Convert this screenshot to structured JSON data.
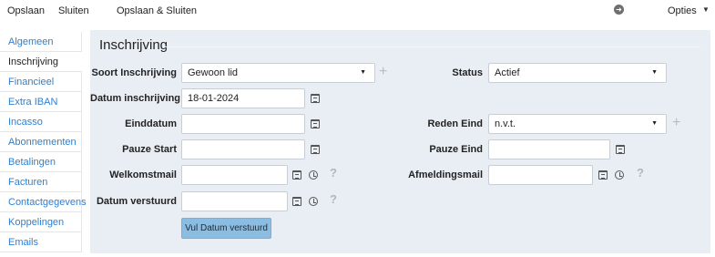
{
  "toolbar": {
    "save_label": "Opslaan",
    "close_label": "Sluiten",
    "save_close_label": "Opslaan & Sluiten",
    "options_label": "Opties"
  },
  "sidebar": {
    "items": [
      {
        "label": "Algemeen"
      },
      {
        "label": "Inschrijving",
        "active": true
      },
      {
        "label": "Financieel"
      },
      {
        "label": "Extra IBAN"
      },
      {
        "label": "Incasso"
      },
      {
        "label": "Abonnementen"
      },
      {
        "label": "Betalingen"
      },
      {
        "label": "Facturen"
      },
      {
        "label": "Contactgegevens"
      },
      {
        "label": "Koppelingen"
      },
      {
        "label": "Emails"
      }
    ]
  },
  "form": {
    "title": "Inschrijving",
    "soort_label": "Soort Inschrijving",
    "soort_value": "Gewoon lid",
    "status_label": "Status",
    "status_value": "Actief",
    "datum_label": "Datum inschrijving",
    "datum_value": "18-01-2024",
    "einddatum_label": "Einddatum",
    "reden_label": "Reden Eind",
    "reden_value": "n.v.t.",
    "pauze_start_label": "Pauze Start",
    "pauze_eind_label": "Pauze Eind",
    "welkom_label": "Welkomstmail",
    "afmeld_label": "Afmeldingsmail",
    "verstuurd_label": "Datum verstuurd",
    "vul_button_label": "Vul Datum verstuurd",
    "help_glyph": "?",
    "plus_glyph": "+"
  },
  "colors": {
    "link": "#2f7fcf",
    "panel_bg": "#e9eef4",
    "button_bg": "#8bbde3"
  }
}
